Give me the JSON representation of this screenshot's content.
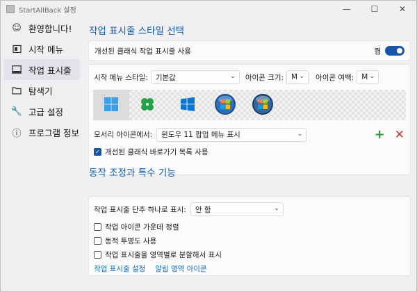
{
  "window": {
    "title": "StartAllBack 설정",
    "controls": [
      "minimize-icon",
      "maximize-icon",
      "close-icon"
    ]
  },
  "sidebar": {
    "items": [
      {
        "label": "환영합니다!",
        "icon": "smiley-icon"
      },
      {
        "label": "시작 메뉴",
        "icon": "start-menu-icon"
      },
      {
        "label": "작업 표시줄",
        "icon": "taskbar-icon"
      },
      {
        "label": "탐색기",
        "icon": "folder-icon"
      },
      {
        "label": "고급 설정",
        "icon": "wrench-icon"
      },
      {
        "label": "프로그램 정보",
        "icon": "info-icon"
      }
    ],
    "active_index": 2
  },
  "taskbar_style": {
    "title": "작업 표시줄 스타일 선택",
    "enhanced_classic_label": "개선된 클래식 작업 표시줄 사용",
    "toggle_label": "켬",
    "toggle_on": true,
    "start_style_label": "시작 메뉴 스타일:",
    "start_style_value": "기본값",
    "icon_size_label": "아이콘 크기:",
    "icon_size_value": "M",
    "icon_margin_label": "아이콘 여백:",
    "icon_margin_value": "M",
    "style_icons": [
      "windows-11-logo-icon",
      "clover-icon",
      "windows-10-logo-icon",
      "windows-7-orb-icon",
      "windows-vista-orb-icon"
    ],
    "selected_style_index": 0,
    "corner_icons_label": "모서리 아이콘에서:",
    "corner_icons_value": "윈도우 11 팝업 메뉴 표시",
    "enhanced_jumplist_label": "개선된 클래식 바로가기 목록 사용",
    "enhanced_jumplist_checked": true
  },
  "behavior": {
    "title": "동작 조정과 특수 기능",
    "combine_label": "작업 표시줄 단추 하나로 표시:",
    "combine_value": "안 함",
    "center_icons_label": "작업 아이콘 가운데 정렬",
    "dynamic_transparency_label": "동적 투명도 사용",
    "split_label": "작업 표시줄을 영역별로 분할해서 표시",
    "links": [
      "작업 표시줄 설정",
      "알림 영역 아이콘"
    ]
  },
  "colors": {
    "accent": "#1556a8",
    "section_title": "#0b5cad",
    "link": "#0b68c9",
    "add": "#1f9d3a",
    "remove": "#c0392b"
  }
}
